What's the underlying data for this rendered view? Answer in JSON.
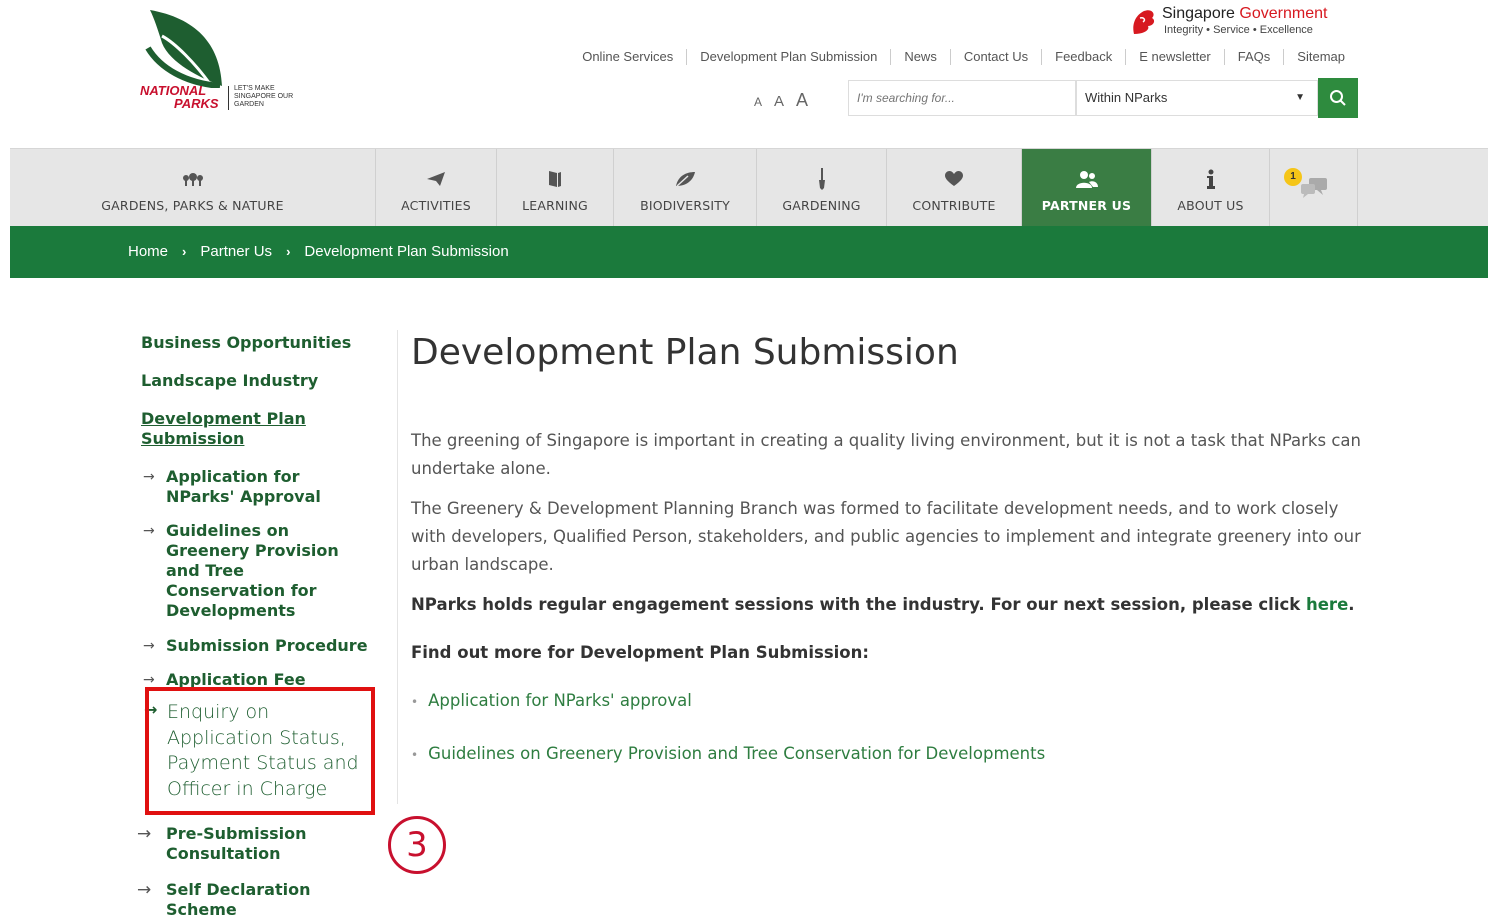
{
  "header": {
    "logo": {
      "brand_line1": "NATIONAL",
      "brand_line2": "PARKS",
      "tagline": "LET'S MAKE SINGAPORE OUR GARDEN"
    },
    "gov": {
      "name_plain": "Singapore ",
      "name_accent": "Government",
      "motto": "Integrity • Service • Excellence"
    },
    "top_links": [
      "Online Services",
      "Development Plan Submission",
      "News",
      "Contact Us",
      "Feedback",
      "E newsletter",
      "FAQs",
      "Sitemap"
    ],
    "font_sizes": [
      "A",
      "A",
      "A"
    ],
    "search": {
      "placeholder": "I'm searching for...",
      "scope": "Within NParks",
      "button_icon": "search-icon"
    }
  },
  "nav": {
    "items": [
      {
        "label": "GARDENS, PARKS & NATURE",
        "icon": "trees-icon"
      },
      {
        "label": "ACTIVITIES",
        "icon": "paper-plane-icon"
      },
      {
        "label": "LEARNING",
        "icon": "book-icon"
      },
      {
        "label": "BIODIVERSITY",
        "icon": "leaf-icon"
      },
      {
        "label": "GARDENING",
        "icon": "trowel-icon"
      },
      {
        "label": "CONTRIBUTE",
        "icon": "heart-icon"
      },
      {
        "label": "PARTNER US",
        "icon": "partners-icon",
        "active": true
      },
      {
        "label": "ABOUT US",
        "icon": "info-icon"
      }
    ],
    "chat": {
      "badge": "1",
      "icon": "chat-icon"
    }
  },
  "breadcrumb": [
    "Home",
    "Partner Us",
    "Development Plan Submission"
  ],
  "sidebar": {
    "level1": [
      "Business Opportunities",
      "Landscape Industry"
    ],
    "current": "Development Plan Submission",
    "level2": [
      "Application for NParks' Approval",
      "Guidelines on Greenery Provision and Tree Conservation for Developments",
      "Submission Procedure",
      "Application Fee",
      "Enquiry on Application Status, Payment Status and Officer in Charge",
      "Pre-Submission Consultation",
      "Self Declaration Scheme"
    ],
    "annotation_number": "3"
  },
  "content": {
    "title": "Development Plan Submission",
    "para1": "The greening of Singapore is important in creating a quality living environment, but it is not a task that NParks can undertake alone.",
    "para2": "The Greenery & Development Planning Branch was formed to facilitate development needs, and to work closely with developers, Qualified Person, stakeholders, and public agencies to implement and integrate greenery into our urban landscape.",
    "engagement_text": "NParks holds regular engagement sessions with the industry.  For our next session, please click ",
    "engagement_link": "here",
    "engagement_end": ".",
    "findout": "Find out more for Development Plan Submission:",
    "links": [
      "Application for NParks' approval",
      "Guidelines on Greenery Provision and Tree Conservation for Developments"
    ]
  },
  "colors": {
    "brand_green": "#1b7a3c",
    "active_nav": "#3a7d44",
    "annotation_red": "#e01010"
  }
}
